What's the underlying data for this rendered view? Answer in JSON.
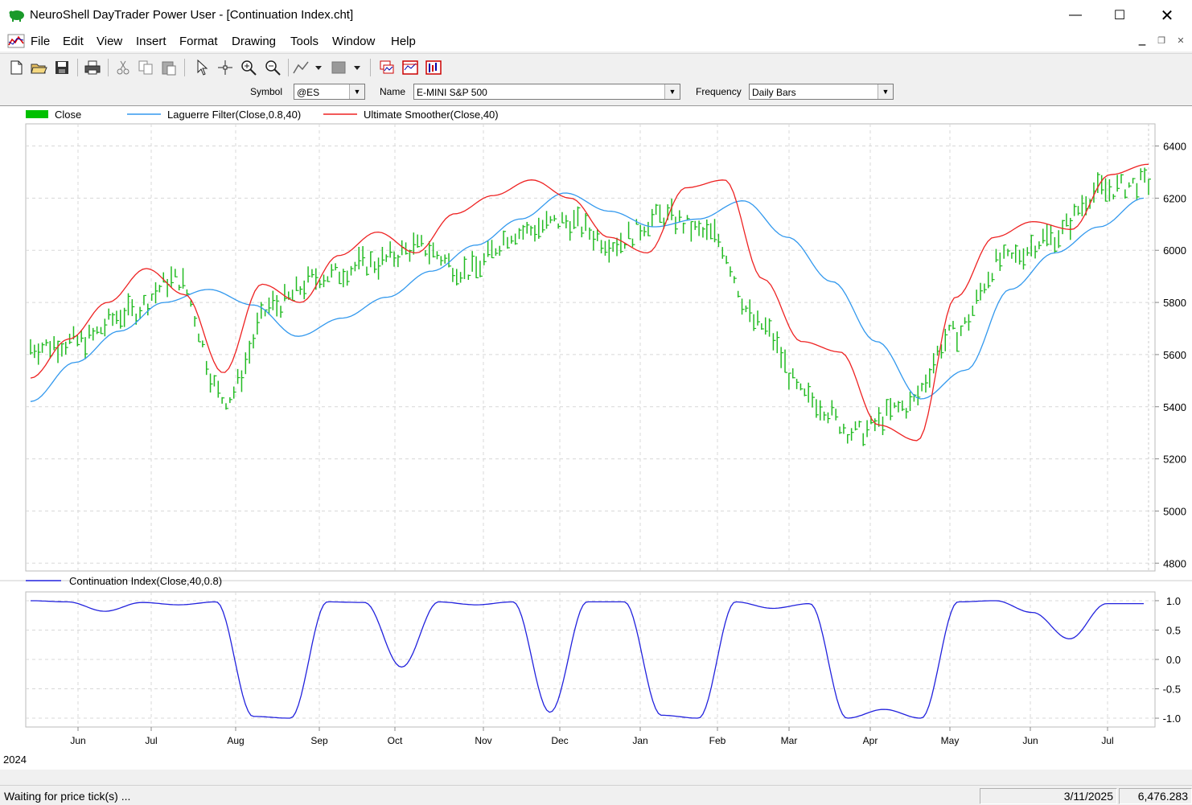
{
  "window": {
    "title": "NeuroShell DayTrader Power User - [Continuation Index.cht]"
  },
  "menu": [
    {
      "label": "File",
      "u": "F",
      "rest": "ile"
    },
    {
      "label": "Edit",
      "u": "E",
      "rest": "dit"
    },
    {
      "label": "View",
      "u": "V",
      "rest": "iew"
    },
    {
      "label": "Insert",
      "u": "I",
      "rest": "nsert"
    },
    {
      "label": "Format",
      "u": "o",
      "rest": ""
    },
    {
      "label": "Drawing",
      "u": "D",
      "rest": "rawing"
    },
    {
      "label": "Tools",
      "u": "T",
      "rest": "ools"
    },
    {
      "label": "Window",
      "u": "W",
      "rest": "indow"
    },
    {
      "label": "Help",
      "u": "H",
      "rest": "elp"
    }
  ],
  "toolbar_icons": [
    "new-file-icon",
    "open-folder-icon",
    "save-icon",
    "print-icon",
    "cut-icon",
    "copy-icon",
    "paste-icon",
    "pointer-icon",
    "crosshair-icon",
    "zoom-in-icon",
    "zoom-out-icon",
    "line-draw-icon",
    "dropdown-arrow-icon",
    "shade-icon",
    "dropdown-arrow-icon",
    "indicator-icon",
    "chart-window-icon",
    "bars-icon"
  ],
  "symbol_bar": {
    "symbol_label": "Symbol",
    "symbol_value": "@ES",
    "name_label": "Name",
    "name_value": "E-MINI S&P 500",
    "frequency_label": "Frequency",
    "frequency_value": "Daily Bars"
  },
  "chart": {
    "legend_top": [
      {
        "name": "Close",
        "color": "#00c000"
      },
      {
        "name": "Laguerre Filter(Close,0.8,40)",
        "color": "#3399ee"
      },
      {
        "name": "Ultimate Smoother(Close,40)",
        "color": "#ee2222"
      }
    ],
    "legend_bottom": [
      {
        "name": "Continuation Index(Close,40,0.8)",
        "color": "#2222dd"
      }
    ],
    "year_label": "2024",
    "months": [
      "Jun",
      "Jul",
      "Aug",
      "Sep",
      "Oct",
      "Nov",
      "Dec",
      "Jan",
      "Feb",
      "Mar",
      "Apr",
      "May",
      "Jun",
      "Jul"
    ],
    "month_x": [
      97,
      188,
      293,
      397,
      491,
      601,
      696,
      796,
      892,
      981,
      1082,
      1181,
      1281,
      1377
    ]
  },
  "chart_data": [
    {
      "type": "line",
      "title": "",
      "ylim": [
        4800,
        6400
      ],
      "yticks": [
        "6400",
        "6200",
        "6000",
        "5800",
        "5600",
        "5400",
        "5200",
        "5000",
        "4800"
      ],
      "x": [
        "Jun",
        "Jul",
        "Aug",
        "Sep",
        "Oct",
        "Nov",
        "Dec",
        "Jan",
        "Feb",
        "Mar",
        "Apr",
        "May",
        "Jun",
        "Jul"
      ],
      "series": [
        {
          "name": "Close",
          "color": "#00c000",
          "values": [
            5630,
            5650,
            5760,
            5890,
            5430,
            5790,
            5900,
            5950,
            6010,
            5920,
            6070,
            6110,
            6030,
            6130,
            6060,
            5710,
            5430,
            5300,
            5400,
            5680,
            5960,
            6050,
            6230,
            6260
          ]
        },
        {
          "name": "Laguerre Filter(Close,0.8,40)",
          "color": "#3399ee",
          "values": [
            5420,
            5570,
            5690,
            5800,
            5850,
            5790,
            5670,
            5740,
            5820,
            5920,
            6020,
            6120,
            6220,
            6150,
            6090,
            6120,
            6190,
            6050,
            5880,
            5650,
            5430,
            5540,
            5850,
            5990,
            6090,
            6200
          ]
        },
        {
          "name": "Ultimate Smoother(Close,40)",
          "color": "#ee2222",
          "values": [
            5510,
            5660,
            5800,
            5930,
            5830,
            5530,
            5870,
            5800,
            5980,
            6070,
            5990,
            6140,
            6210,
            6270,
            6200,
            6050,
            5990,
            6240,
            6270,
            5890,
            5650,
            5610,
            5330,
            5270,
            5820,
            6050,
            6110,
            6080,
            6290,
            6330
          ]
        }
      ]
    },
    {
      "type": "line",
      "ylim": [
        -1.0,
        1.0
      ],
      "yticks": [
        "1.0",
        "0.5",
        "0.0",
        "-0.5",
        "-1.0"
      ],
      "series": [
        {
          "name": "Continuation Index(Close,40,0.8)",
          "color": "#2222dd",
          "values": [
            1.0,
            0.98,
            0.82,
            0.97,
            0.93,
            0.98,
            -0.97,
            -1.0,
            0.98,
            0.97,
            -0.13,
            0.98,
            0.93,
            0.98,
            -0.9,
            0.98,
            0.98,
            -0.95,
            -1.0,
            0.98,
            0.87,
            0.95,
            -1.0,
            -0.85,
            -1.0,
            0.98,
            1.0,
            0.8,
            0.35,
            0.95,
            0.95
          ]
        }
      ]
    }
  ],
  "status": {
    "message": "Waiting for price tick(s) ...",
    "date": "3/11/2025",
    "value": "6,476.283"
  }
}
